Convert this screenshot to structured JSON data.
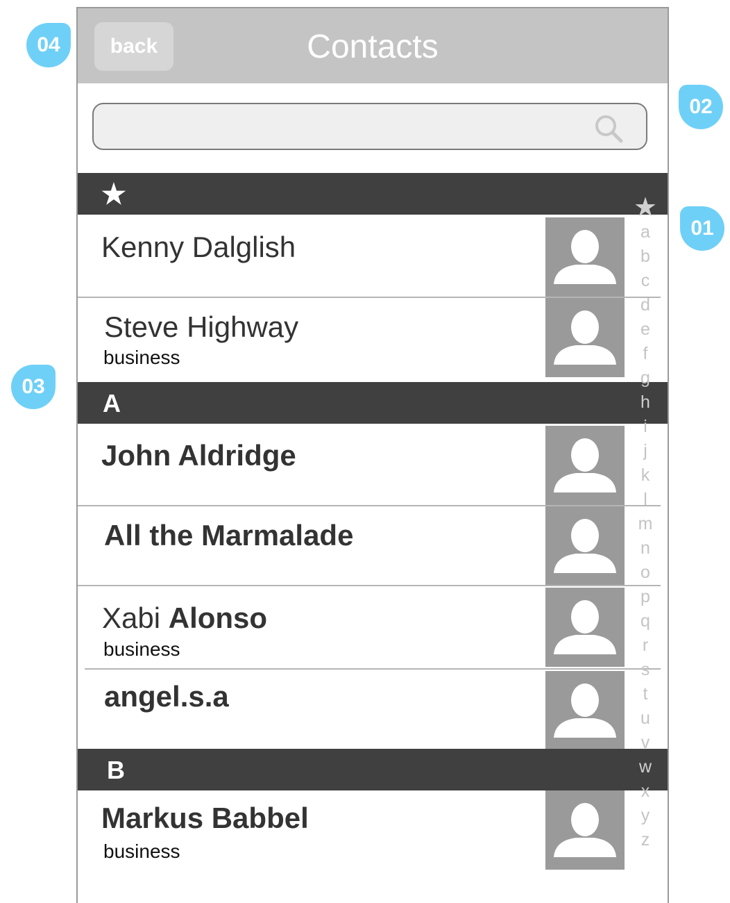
{
  "navbar": {
    "back_label": "back",
    "title": "Contacts"
  },
  "search": {
    "placeholder": ""
  },
  "sections": {
    "favorites": {
      "label": "★"
    },
    "a": {
      "label": "A"
    },
    "b": {
      "label": "B"
    }
  },
  "contacts": [
    {
      "first": "Kenny Dalglish",
      "last": "",
      "sub": ""
    },
    {
      "first": "Steve Highway",
      "last": "",
      "sub": "business"
    },
    {
      "first": "John Aldridge",
      "last": "",
      "sub": ""
    },
    {
      "first": "All the Marmalade",
      "last": "",
      "sub": ""
    },
    {
      "first": "Xabi ",
      "last": "Alonso",
      "sub": "business"
    },
    {
      "first": "angel.s.a",
      "last": "",
      "sub": ""
    },
    {
      "first": "Markus Babbel",
      "last": "",
      "sub": "business"
    }
  ],
  "index_letters": [
    "★",
    "a",
    "b",
    "c",
    "d",
    "e",
    "f",
    "g",
    "h",
    "i",
    "j",
    "k",
    "l",
    "m",
    "n",
    "o",
    "p",
    "q",
    "r",
    "s",
    "t",
    "u",
    "v",
    "w",
    "x",
    "y",
    "z"
  ],
  "callouts": {
    "c01": "01",
    "c02": "02",
    "c03": "03",
    "c04": "04"
  },
  "colors": {
    "accent": "#6fd0f7",
    "navbar": "#c4c4c4",
    "section": "#404040",
    "avatar": "#9a9a9a"
  }
}
